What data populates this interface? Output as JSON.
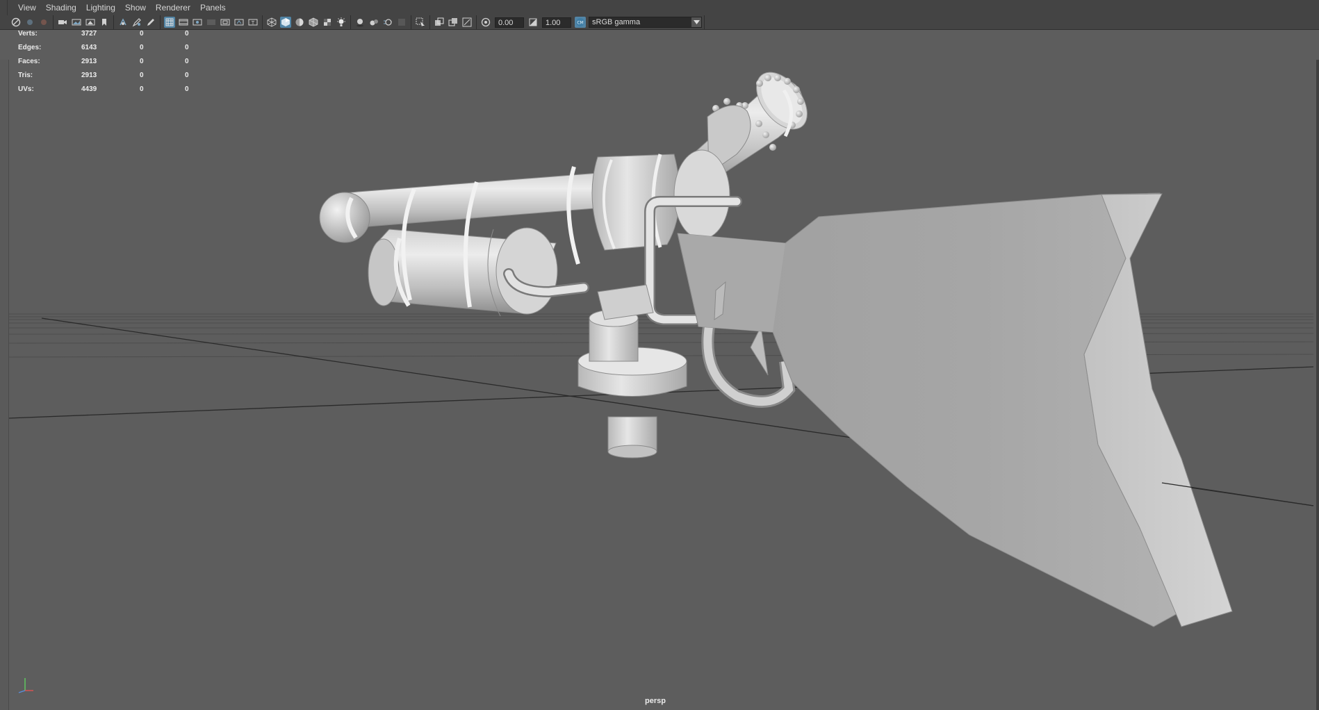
{
  "menu": [
    "View",
    "Shading",
    "Lighting",
    "Show",
    "Renderer",
    "Panels"
  ],
  "toolbar": {
    "exposure_value": "0.00",
    "gamma_value": "1.00",
    "color_space": "sRGB gamma"
  },
  "hud": {
    "rows": [
      {
        "label": "Verts:",
        "values": [
          "3727",
          "0",
          "0"
        ]
      },
      {
        "label": "Edges:",
        "values": [
          "6143",
          "0",
          "0"
        ]
      },
      {
        "label": "Faces:",
        "values": [
          "2913",
          "0",
          "0"
        ]
      },
      {
        "label": "Tris:",
        "values": [
          "2913",
          "0",
          "0"
        ]
      },
      {
        "label": "UVs:",
        "values": [
          "4439",
          "0",
          "0"
        ]
      }
    ]
  },
  "camera_label": "persp",
  "colors": {
    "viewport_bg": "#5d5d5d",
    "panel_bg": "#444444",
    "accent": "#5285a6",
    "model": "#c8c8c8"
  }
}
